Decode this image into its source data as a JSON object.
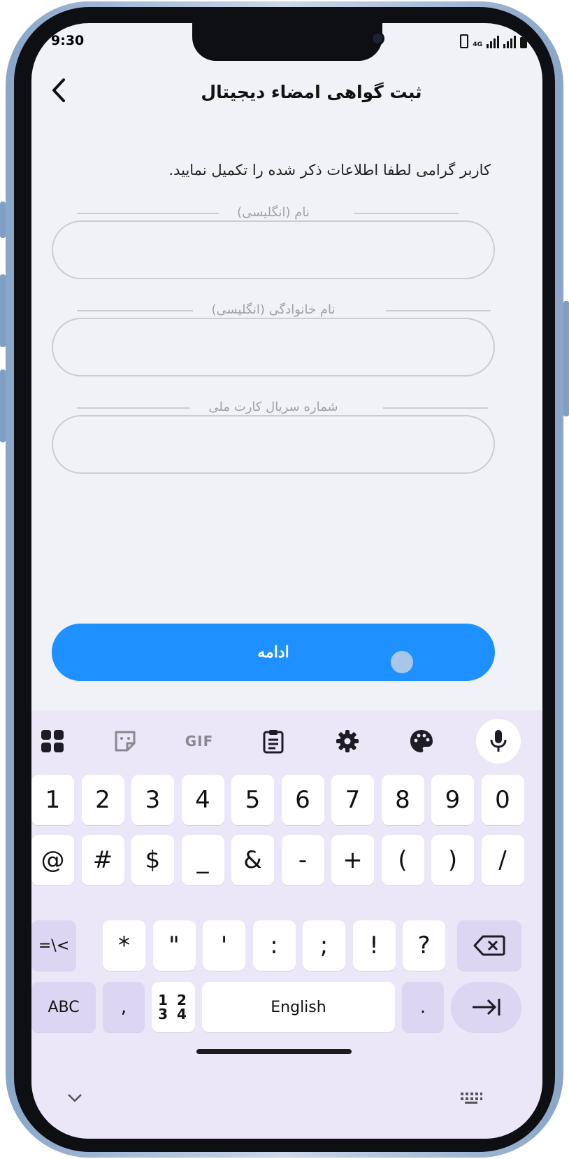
{
  "status_bar": {
    "time": "9:30",
    "network": "4G"
  },
  "header": {
    "title": "ثبت گواهی امضاء دیجیتال",
    "back_icon": "chevron-left-icon"
  },
  "instruction": "کاربر گرامی لطفا اطلاعات ذکر شده را تکمیل نمایید.",
  "form": {
    "fields": [
      {
        "label": "نام (انگلیسی)",
        "value": ""
      },
      {
        "label": "نام خانوادگی (انگلیسی)",
        "value": ""
      },
      {
        "label": "شماره سریال کارت ملی",
        "value": ""
      }
    ],
    "submit_label": "ادامه"
  },
  "keyboard": {
    "toolbar": [
      "apps-grid-icon",
      "sticker-icon",
      "gif-icon",
      "clipboard-icon",
      "settings-gear-icon",
      "palette-icon",
      "microphone-icon"
    ],
    "gif_label": "GIF",
    "row1": [
      "1",
      "2",
      "3",
      "4",
      "5",
      "6",
      "7",
      "8",
      "9",
      "0"
    ],
    "row2": [
      "@",
      "#",
      "$",
      "_",
      "&",
      "-",
      "+",
      "(",
      ")",
      "/"
    ],
    "row3_left": "=\\<",
    "row3": [
      "*",
      "\"",
      "'",
      ":",
      ";",
      "!",
      "?"
    ],
    "row3_right_icon": "backspace-icon",
    "row4": {
      "abc": "ABC",
      "comma": ",",
      "numpad_top": "1 2",
      "numpad_bottom": "3 4",
      "space": "English",
      "period": ".",
      "enter_icon": "tab-arrow-icon"
    },
    "bottom": {
      "left_icon": "chevron-down-icon",
      "right_icon": "keyboard-icon"
    }
  }
}
